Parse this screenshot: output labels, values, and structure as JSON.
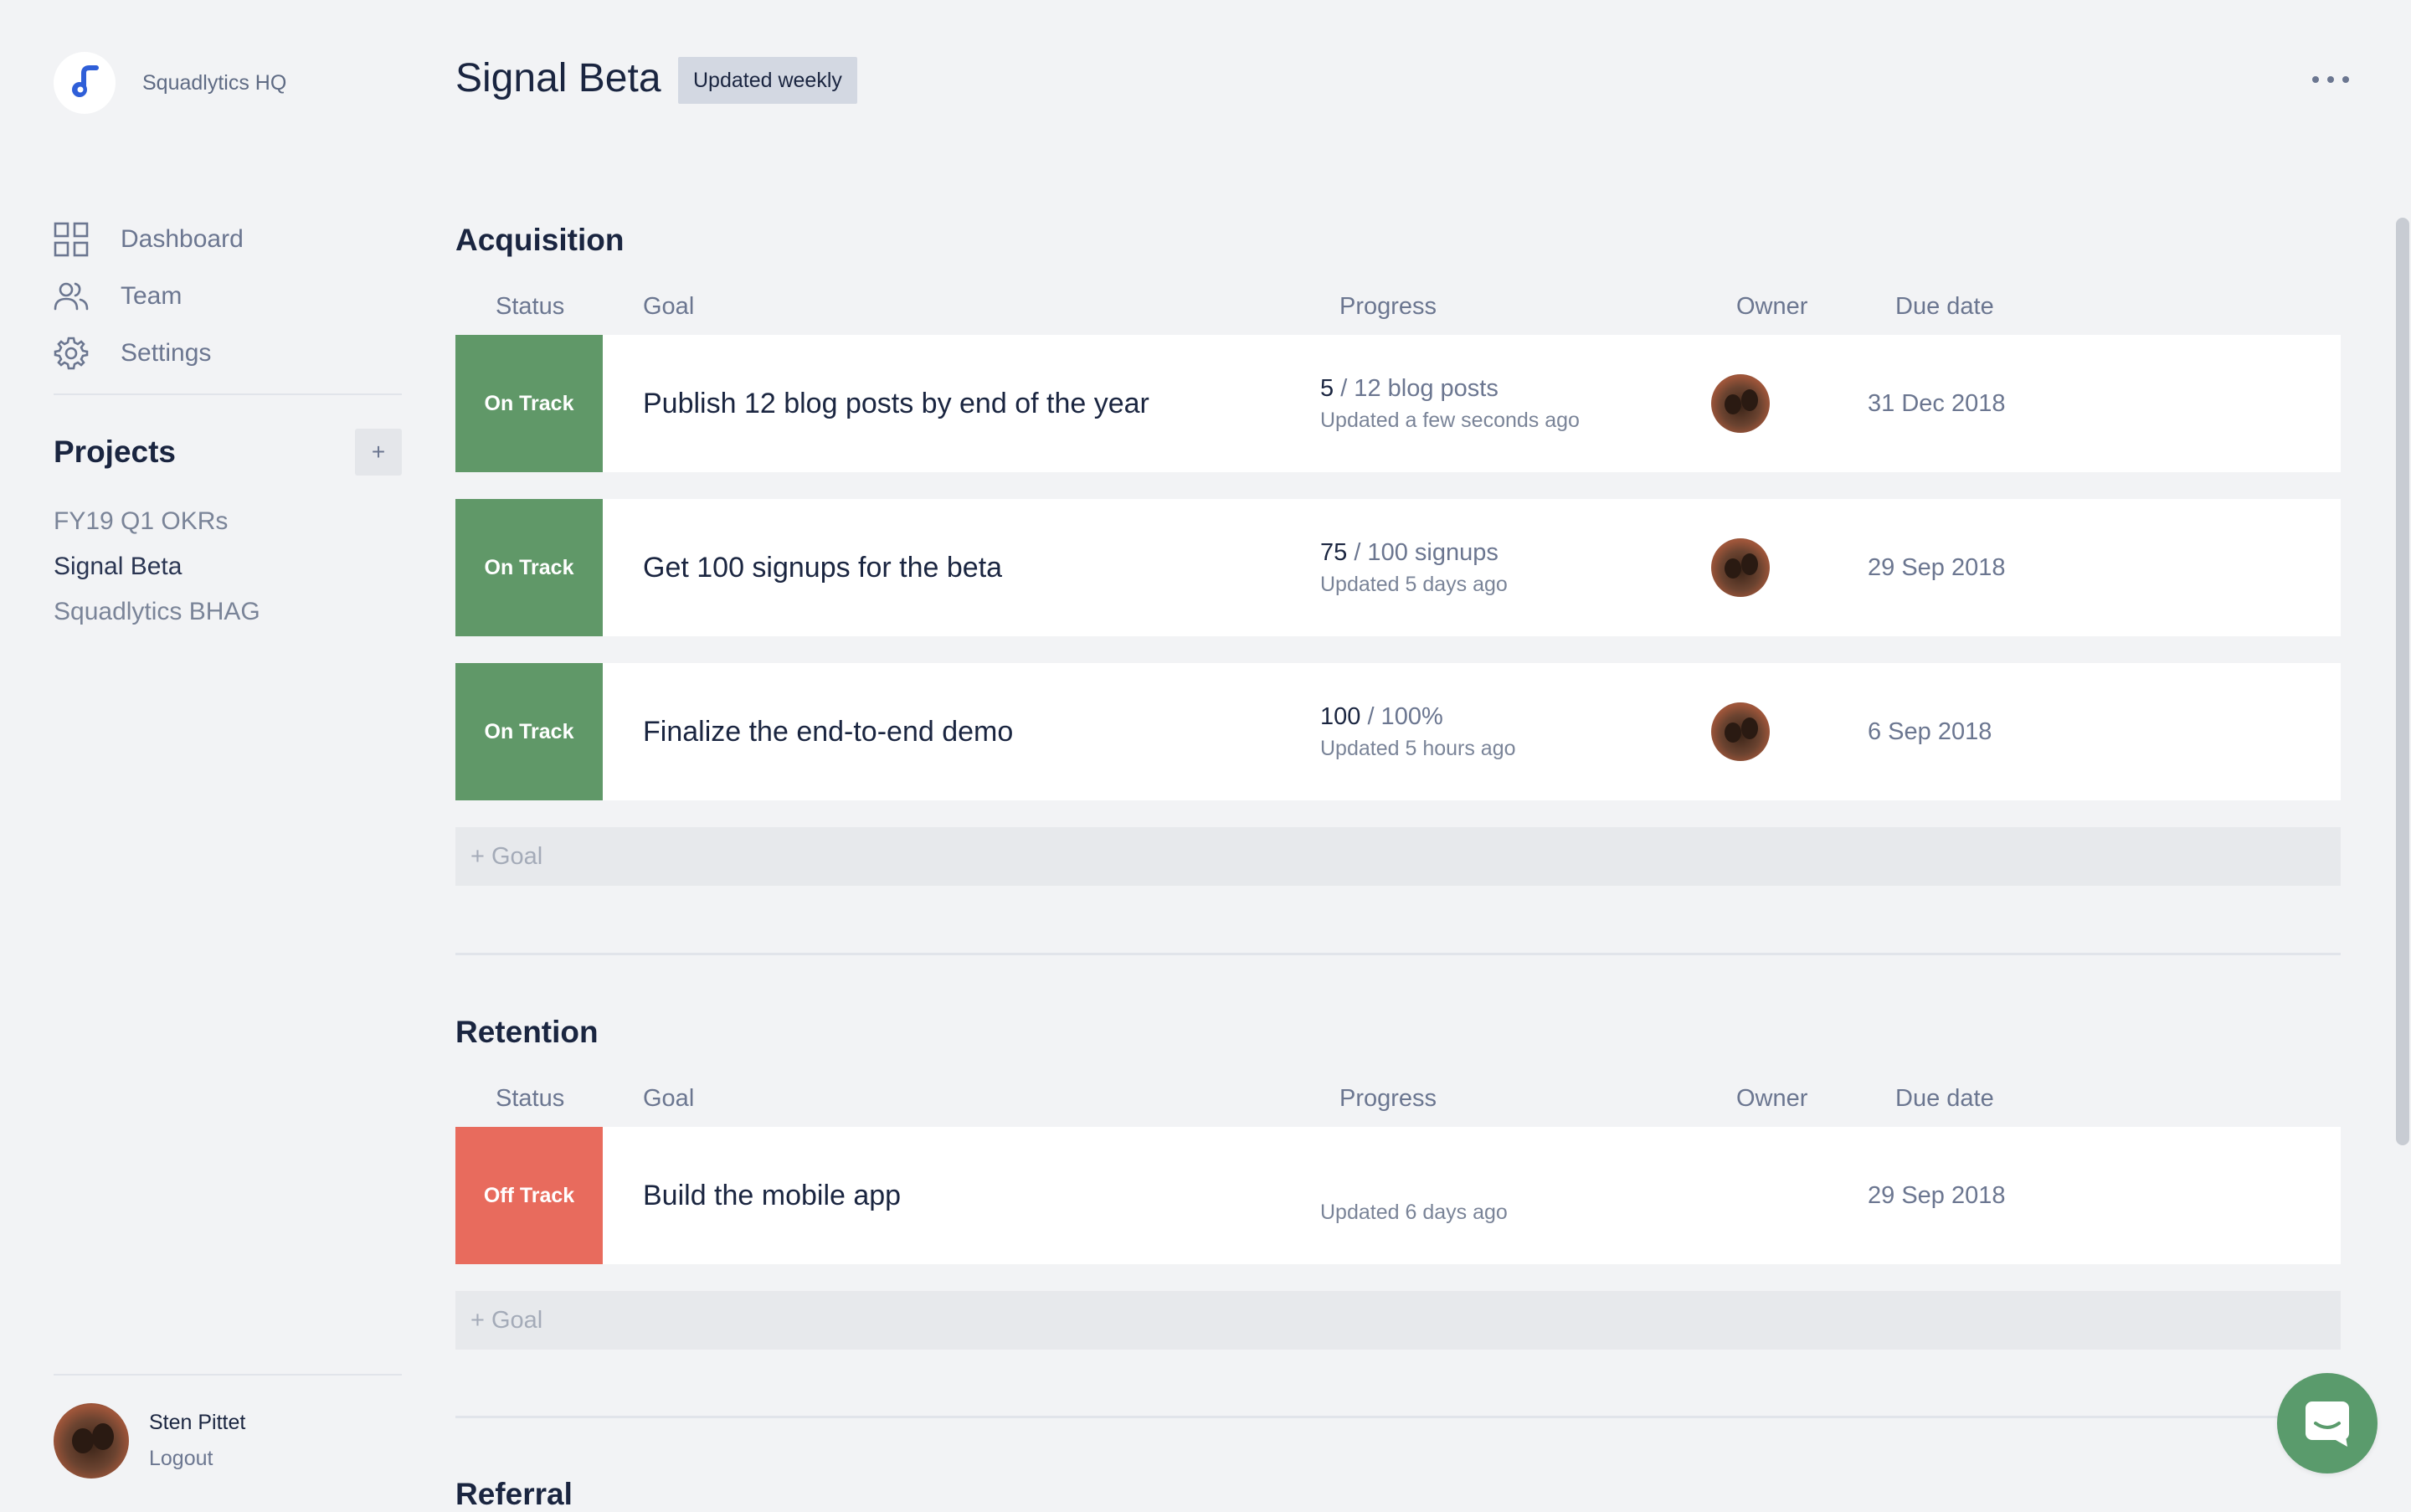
{
  "workspace": {
    "name": "Squadlytics HQ",
    "logo_icon": "squadlytics-logo-icon"
  },
  "nav": [
    {
      "label": "Dashboard",
      "icon": "dashboard-grid-icon"
    },
    {
      "label": "Team",
      "icon": "team-users-icon"
    },
    {
      "label": "Settings",
      "icon": "gear-icon"
    }
  ],
  "projects": {
    "title": "Projects",
    "add_label": "+",
    "items": [
      {
        "label": "FY19 Q1 OKRs",
        "active": false
      },
      {
        "label": "Signal Beta",
        "active": true
      },
      {
        "label": "Squadlytics BHAG",
        "active": false
      }
    ]
  },
  "user": {
    "name": "Sten Pittet",
    "logout": "Logout"
  },
  "header": {
    "title": "Signal Beta",
    "badge": "Updated weekly",
    "more_icon": "ellipsis-icon"
  },
  "columns": {
    "status": "Status",
    "goal": "Goal",
    "progress": "Progress",
    "owner": "Owner",
    "due": "Due date"
  },
  "sections": [
    {
      "title": "Acquisition",
      "add_goal": "+ Goal",
      "goals": [
        {
          "status": "On Track",
          "goal": "Publish 12 blog posts by end of the year",
          "progress_current": "5",
          "progress_target": " / 12 blog posts",
          "updated": "Updated a few seconds ago",
          "due": "31 Dec 2018",
          "has_owner": true
        },
        {
          "status": "On Track",
          "goal": "Get 100 signups for the beta",
          "progress_current": "75",
          "progress_target": " / 100 signups",
          "updated": "Updated 5 days ago",
          "due": "29 Sep 2018",
          "has_owner": true
        },
        {
          "status": "On Track",
          "goal": "Finalize the end-to-end demo",
          "progress_current": "100",
          "progress_target": " / 100%",
          "updated": "Updated 5 hours ago",
          "due": "6 Sep 2018",
          "has_owner": true
        }
      ]
    },
    {
      "title": "Retention",
      "add_goal": "+ Goal",
      "goals": [
        {
          "status": "Off Track",
          "goal": "Build the mobile app",
          "progress_current": "",
          "progress_target": "",
          "updated": "Updated 6 days ago",
          "due": "29 Sep 2018",
          "has_owner": false
        }
      ]
    },
    {
      "title": "Referral"
    }
  ],
  "colors": {
    "on_track": "#609868",
    "off_track": "#e86b5d",
    "chat": "#5a9b6c",
    "background": "#f2f3f5"
  },
  "chat_icon": "chat-bubble-icon"
}
